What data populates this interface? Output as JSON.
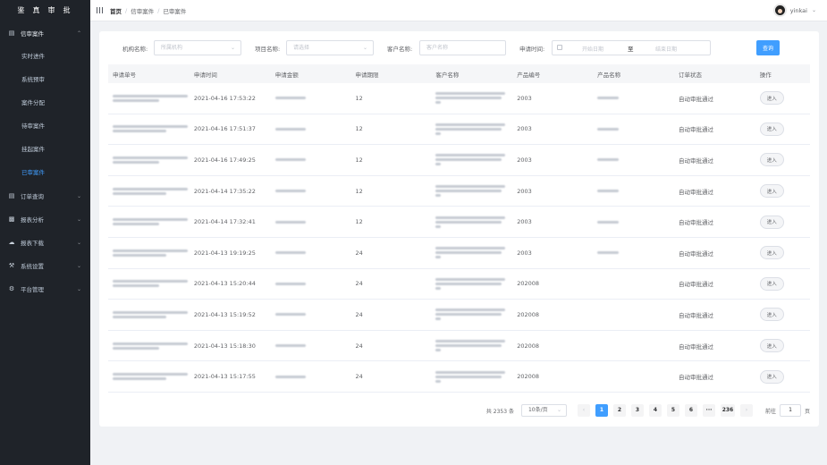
{
  "sidebar": {
    "logo": "鉴真审批",
    "menu": [
      {
        "label": "信审案件",
        "icon": "document-icon",
        "open": true
      },
      {
        "label": "订单查询",
        "icon": "list-icon"
      },
      {
        "label": "报表分析",
        "icon": "chart-icon"
      },
      {
        "label": "报表下载",
        "icon": "download-icon"
      },
      {
        "label": "系统设置",
        "icon": "wrench-icon"
      },
      {
        "label": "平台管理",
        "icon": "gear-icon"
      }
    ],
    "submenu": [
      "实时进件",
      "系统预审",
      "案件分配",
      "待审案件",
      "挂起案件",
      "已审案件"
    ],
    "active_submenu": "已审案件"
  },
  "header": {
    "breadcrumb": [
      "首页",
      "信审案件",
      "已审案件"
    ],
    "username": "yinkai"
  },
  "filters": {
    "org_label": "机构名称:",
    "org_placeholder": "所属机构",
    "project_label": "项目名称:",
    "project_placeholder": "请选择",
    "customer_label": "客户名称:",
    "customer_placeholder": "客户名称",
    "date_label": "申请时间:",
    "date_start": "开始日期",
    "date_sep": "至",
    "date_end": "结束日期",
    "query_button": "查询"
  },
  "table": {
    "columns": [
      "申请单号",
      "申请时间",
      "申请金额",
      "申请期限",
      "客户名称",
      "产品编号",
      "产品名称",
      "订单状态",
      "操作"
    ],
    "rows": [
      {
        "time": "2021-04-16 17:53:22",
        "term": "12",
        "product_no": "2003",
        "status": "自动审批通过",
        "action": "进入",
        "has_product_name": true
      },
      {
        "time": "2021-04-16 17:51:37",
        "term": "12",
        "product_no": "2003",
        "status": "自动审批通过",
        "action": "进入",
        "has_product_name": true
      },
      {
        "time": "2021-04-16 17:49:25",
        "term": "12",
        "product_no": "2003",
        "status": "自动审批通过",
        "action": "进入",
        "has_product_name": true
      },
      {
        "time": "2021-04-14 17:35:22",
        "term": "12",
        "product_no": "2003",
        "status": "自动审批通过",
        "action": "进入",
        "has_product_name": true
      },
      {
        "time": "2021-04-14 17:32:41",
        "term": "12",
        "product_no": "2003",
        "status": "自动审批通过",
        "action": "进入",
        "has_product_name": true
      },
      {
        "time": "2021-04-13 19:19:25",
        "term": "24",
        "product_no": "2003",
        "status": "自动审批通过",
        "action": "进入",
        "has_product_name": true
      },
      {
        "time": "2021-04-13 15:20:44",
        "term": "24",
        "product_no": "202008",
        "status": "自动审批通过",
        "action": "进入",
        "has_product_name": false
      },
      {
        "time": "2021-04-13 15:19:52",
        "term": "24",
        "product_no": "202008",
        "status": "自动审批通过",
        "action": "进入",
        "has_product_name": false
      },
      {
        "time": "2021-04-13 15:18:30",
        "term": "24",
        "product_no": "202008",
        "status": "自动审批通过",
        "action": "进入",
        "has_product_name": false
      },
      {
        "time": "2021-04-13 15:17:55",
        "term": "24",
        "product_no": "202008",
        "status": "自动审批通过",
        "action": "进入",
        "has_product_name": false
      }
    ]
  },
  "pagination": {
    "total": "共 2353 条",
    "page_size": "10条/页",
    "pages": [
      "1",
      "2",
      "3",
      "4",
      "5",
      "6",
      "···",
      "236"
    ],
    "current_page": "1",
    "prev": "‹",
    "next": "›",
    "goto_label": "前往",
    "goto_value": "1",
    "goto_unit": "页"
  },
  "colors": {
    "sidebar_bg": "#1f2329",
    "accent": "#409eff"
  }
}
